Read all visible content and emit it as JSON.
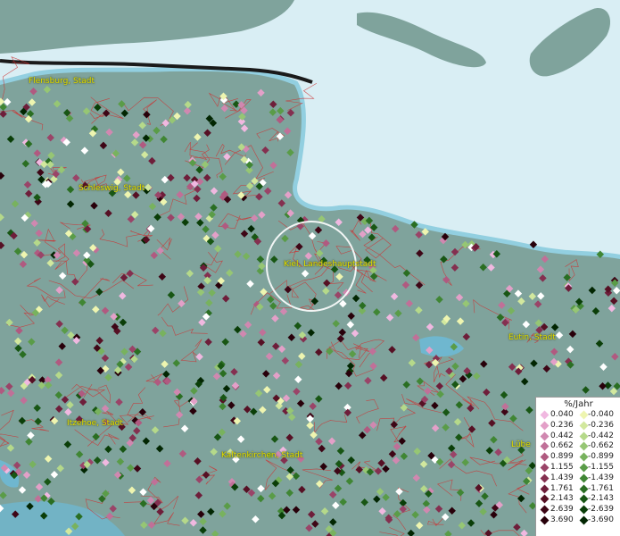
{
  "map": {
    "colors": {
      "land": "#7fa39c",
      "water": "#d9eef4",
      "coast": "#57b7d0",
      "border": "#cc3333"
    }
  },
  "cities": [
    {
      "name": "Flensburg, Stadt"
    },
    {
      "name": "Schleswig, Stadt"
    },
    {
      "name": "Kiel, Landeshauptstadt"
    },
    {
      "name": "Eutin, Stadt"
    },
    {
      "name": "Itzehoe, Stadt"
    },
    {
      "name": "Kaltenkirchen, Stadt"
    },
    {
      "name": "Lübe"
    }
  ],
  "legend": {
    "title": "%/Jahr",
    "positive": [
      {
        "label": "0.040",
        "color": "#f0b8e0"
      },
      {
        "label": "0.236",
        "color": "#e3a0c8"
      },
      {
        "label": "0.442",
        "color": "#d088b0"
      },
      {
        "label": "0.662",
        "color": "#c07098"
      },
      {
        "label": "0.899",
        "color": "#b05a80"
      },
      {
        "label": "1.155",
        "color": "#9a4468"
      },
      {
        "label": "1.439",
        "color": "#843050"
      },
      {
        "label": "1.761",
        "color": "#6e1e3a"
      },
      {
        "label": "2.143",
        "color": "#561024"
      },
      {
        "label": "2.639",
        "color": "#3e0616"
      },
      {
        "label": "3.690",
        "color": "#28000a"
      }
    ],
    "negative": [
      {
        "label": "-0.040",
        "color": "#eef5b0"
      },
      {
        "label": "-0.236",
        "color": "#d2e89e"
      },
      {
        "label": "-0.442",
        "color": "#b5d98a"
      },
      {
        "label": "-0.662",
        "color": "#96c674"
      },
      {
        "label": "-0.899",
        "color": "#78b25e"
      },
      {
        "label": "-1.155",
        "color": "#5a9c48"
      },
      {
        "label": "-1.439",
        "color": "#408634"
      },
      {
        "label": "-1.761",
        "color": "#2a6e22"
      },
      {
        "label": "-2.143",
        "color": "#185614"
      },
      {
        "label": "-2.639",
        "color": "#0a3e08"
      },
      {
        "label": "-3.690",
        "color": "#022602"
      }
    ]
  }
}
